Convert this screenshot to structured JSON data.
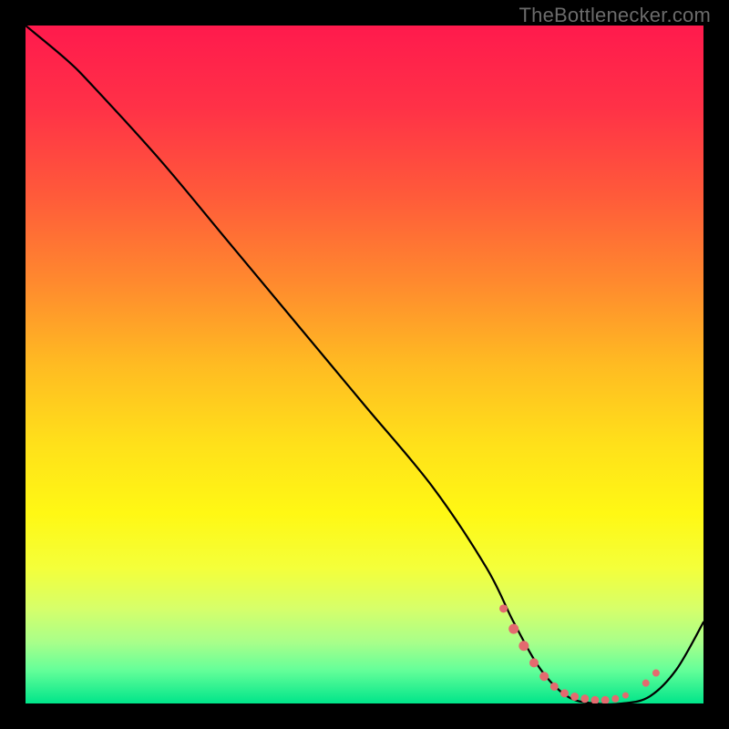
{
  "watermark": "TheBottlenecker.com",
  "gradient_stops": [
    {
      "offset": 0.0,
      "color": "#ff1a4d"
    },
    {
      "offset": 0.12,
      "color": "#ff3147"
    },
    {
      "offset": 0.25,
      "color": "#ff5a3a"
    },
    {
      "offset": 0.38,
      "color": "#ff8a2e"
    },
    {
      "offset": 0.5,
      "color": "#ffbb22"
    },
    {
      "offset": 0.62,
      "color": "#ffe11a"
    },
    {
      "offset": 0.72,
      "color": "#fff814"
    },
    {
      "offset": 0.8,
      "color": "#f4ff3a"
    },
    {
      "offset": 0.86,
      "color": "#d6ff6a"
    },
    {
      "offset": 0.91,
      "color": "#a8ff8a"
    },
    {
      "offset": 0.95,
      "color": "#66ff99"
    },
    {
      "offset": 1.0,
      "color": "#00e58a"
    }
  ],
  "chart_data": {
    "type": "line",
    "title": "",
    "xlabel": "",
    "ylabel": "",
    "xlim": [
      0,
      100
    ],
    "ylim": [
      0,
      100
    ],
    "series": [
      {
        "name": "bottleneck-curve",
        "x": [
          0,
          6,
          10,
          20,
          30,
          40,
          50,
          60,
          68,
          72,
          76,
          80,
          84,
          88,
          92,
          96,
          100
        ],
        "y": [
          100,
          95,
          91,
          80,
          68,
          56,
          44,
          32,
          20,
          12,
          5,
          1,
          0,
          0,
          1,
          5,
          12
        ]
      }
    ],
    "markers": {
      "name": "highlight-points",
      "color": "#e46a6f",
      "points": [
        {
          "x": 70.5,
          "y": 14.0,
          "r": 4.5
        },
        {
          "x": 72.0,
          "y": 11.0,
          "r": 5.5
        },
        {
          "x": 73.5,
          "y": 8.5,
          "r": 5.5
        },
        {
          "x": 75.0,
          "y": 6.0,
          "r": 5.0
        },
        {
          "x": 76.5,
          "y": 4.0,
          "r": 5.0
        },
        {
          "x": 78.0,
          "y": 2.5,
          "r": 4.5
        },
        {
          "x": 79.5,
          "y": 1.5,
          "r": 4.5
        },
        {
          "x": 81.0,
          "y": 1.0,
          "r": 4.5
        },
        {
          "x": 82.5,
          "y": 0.7,
          "r": 4.5
        },
        {
          "x": 84.0,
          "y": 0.5,
          "r": 4.5
        },
        {
          "x": 85.5,
          "y": 0.5,
          "r": 4.5
        },
        {
          "x": 87.0,
          "y": 0.7,
          "r": 4.0
        },
        {
          "x": 88.5,
          "y": 1.2,
          "r": 3.5
        },
        {
          "x": 91.5,
          "y": 3.0,
          "r": 4.0
        },
        {
          "x": 93.0,
          "y": 4.5,
          "r": 4.0
        }
      ]
    }
  }
}
